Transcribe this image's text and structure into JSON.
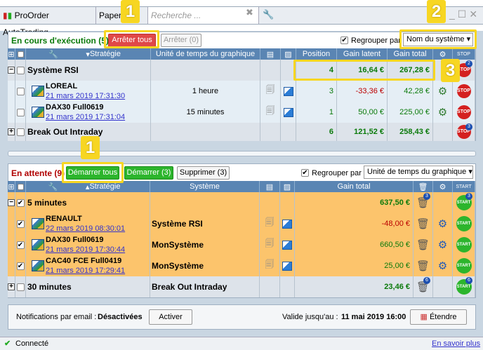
{
  "window": {
    "app_tab": "ProOrder AutoTrading",
    "tab2": "Paper",
    "search_placeholder": "Recherche ..."
  },
  "running": {
    "title": "En cours d'exécution (5)",
    "stop_all": "Arrêter tous",
    "stop": "Arrêter (0)",
    "group_by_label": "Regrouper par",
    "group_by_value": "Nom du système",
    "columns": {
      "strategy": "Stratégie",
      "timeframe": "Unité de temps du graphique",
      "position": "Position",
      "latent": "Gain latent",
      "total": "Gain total",
      "stop": "STOP"
    },
    "groups": [
      {
        "name": "Système RSI",
        "position": "4",
        "latent": "16,64 €",
        "total": "267,28 €",
        "badge": "2",
        "expanded": true,
        "rows": [
          {
            "name": "LOREAL",
            "date": "21 mars 2019 17:31:30",
            "timeframe": "1 heure",
            "position": "3",
            "latent": "-33,36 €",
            "total": "42,28 €"
          },
          {
            "name": "DAX30 Full0619",
            "date": "21 mars 2019 17:31:04",
            "timeframe": "15 minutes",
            "position": "1",
            "latent": "50,00 €",
            "total": "225,00 €"
          }
        ]
      },
      {
        "name": "Break Out Intraday",
        "position": "6",
        "latent": "121,52 €",
        "total": "258,43 €",
        "badge": "3",
        "expanded": false
      }
    ]
  },
  "pending": {
    "title": "En attente (9)",
    "start_all": "Démarrer tous",
    "start": "Démarrer (3)",
    "delete": "Supprimer (3)",
    "group_by_label": "Regrouper par",
    "group_by_value": "Unité de temps du graphique",
    "columns": {
      "strategy": "Stratégie",
      "system": "Système",
      "total": "Gain total",
      "start": "START"
    },
    "groups": [
      {
        "name": "5 minutes",
        "total": "637,50 €",
        "badge": "3",
        "checked": true,
        "rows": [
          {
            "name": "RENAULT",
            "date": "22 mars 2019 08:30:01",
            "system": "Système RSI",
            "total": "-48,00 €"
          },
          {
            "name": "DAX30 Full0619",
            "date": "21 mars 2019 17:30:44",
            "system": "MonSystème",
            "total": "660,50 €"
          },
          {
            "name": "CAC40 FCE Full0419",
            "date": "21 mars 2019 17:29:41",
            "system": "MonSystème",
            "total": "25,00 €"
          }
        ]
      },
      {
        "name": "30 minutes",
        "system": "Break Out Intraday",
        "total": "23,46 €",
        "badge": "6",
        "checked": false
      }
    ]
  },
  "footer": {
    "notif_label": "Notifications par email :",
    "notif_value": "Désactivées",
    "activate": "Activer",
    "valid_label": "Valide jusqu'au :",
    "valid_value": "11 mai 2019 16:00",
    "extend": "Étendre"
  },
  "status": {
    "connected": "Connecté",
    "learn_more": "En savoir plus"
  },
  "callouts": [
    "1",
    "2",
    "3",
    "1"
  ],
  "colors": {
    "running_title": "#0a7a0a",
    "pending_title": "#b00000",
    "stop_all_bg": "#e04848",
    "start_bg": "#2cb52c",
    "highlight": "#f7d622",
    "pending_row": "#fcc46c"
  }
}
